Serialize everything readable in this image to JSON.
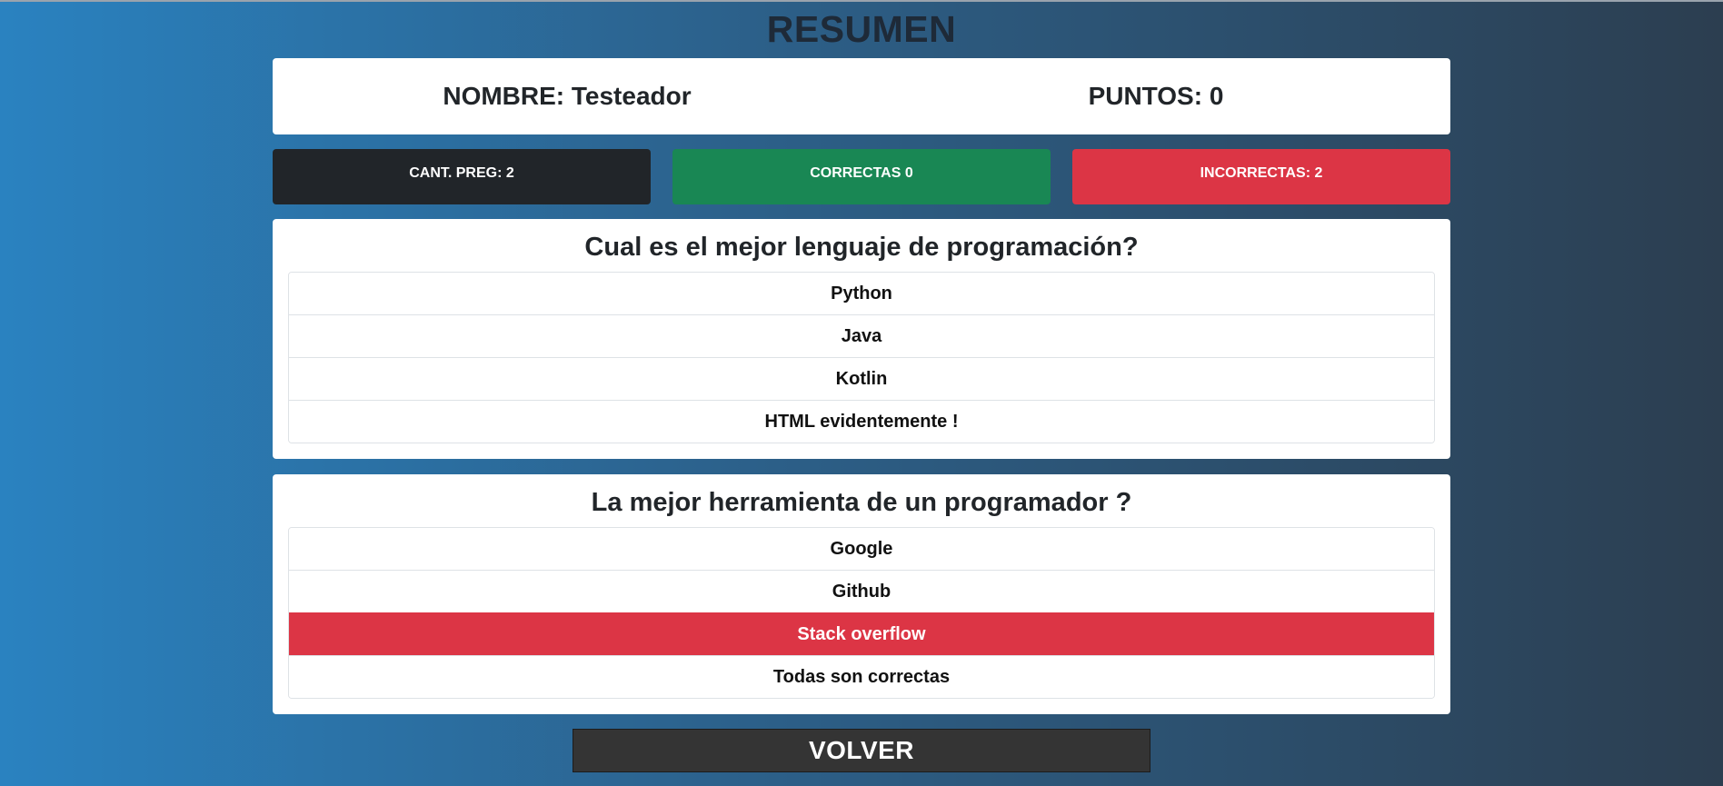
{
  "page": {
    "title": "RESUMEN"
  },
  "player": {
    "name_text": "NOMBRE: Testeador",
    "points_text": "PUNTOS: 0"
  },
  "stats": {
    "total_text": "CANT. PREG: 2",
    "correct_text": "CORRECTAS 0",
    "incorrect_text": "INCORRECTAS: 2"
  },
  "questions": [
    {
      "title": "Cual es el mejor lenguaje de programación?",
      "answers": [
        "Python",
        "Java",
        "Kotlin",
        "HTML evidentemente !"
      ]
    },
    {
      "title": "La mejor herramienta de un programador ?",
      "answers": [
        "Google",
        "Github",
        "Stack overflow",
        "Todas son correctas"
      ],
      "selected_wrong_index": 2
    }
  ],
  "back_button": {
    "label": "VOLVER"
  },
  "colors": {
    "total_bg": "#212529",
    "correct_bg": "#198754",
    "incorrect_bg": "#dc3545",
    "wrong_answer_bg": "#dc3545",
    "button_bg": "#343434"
  }
}
